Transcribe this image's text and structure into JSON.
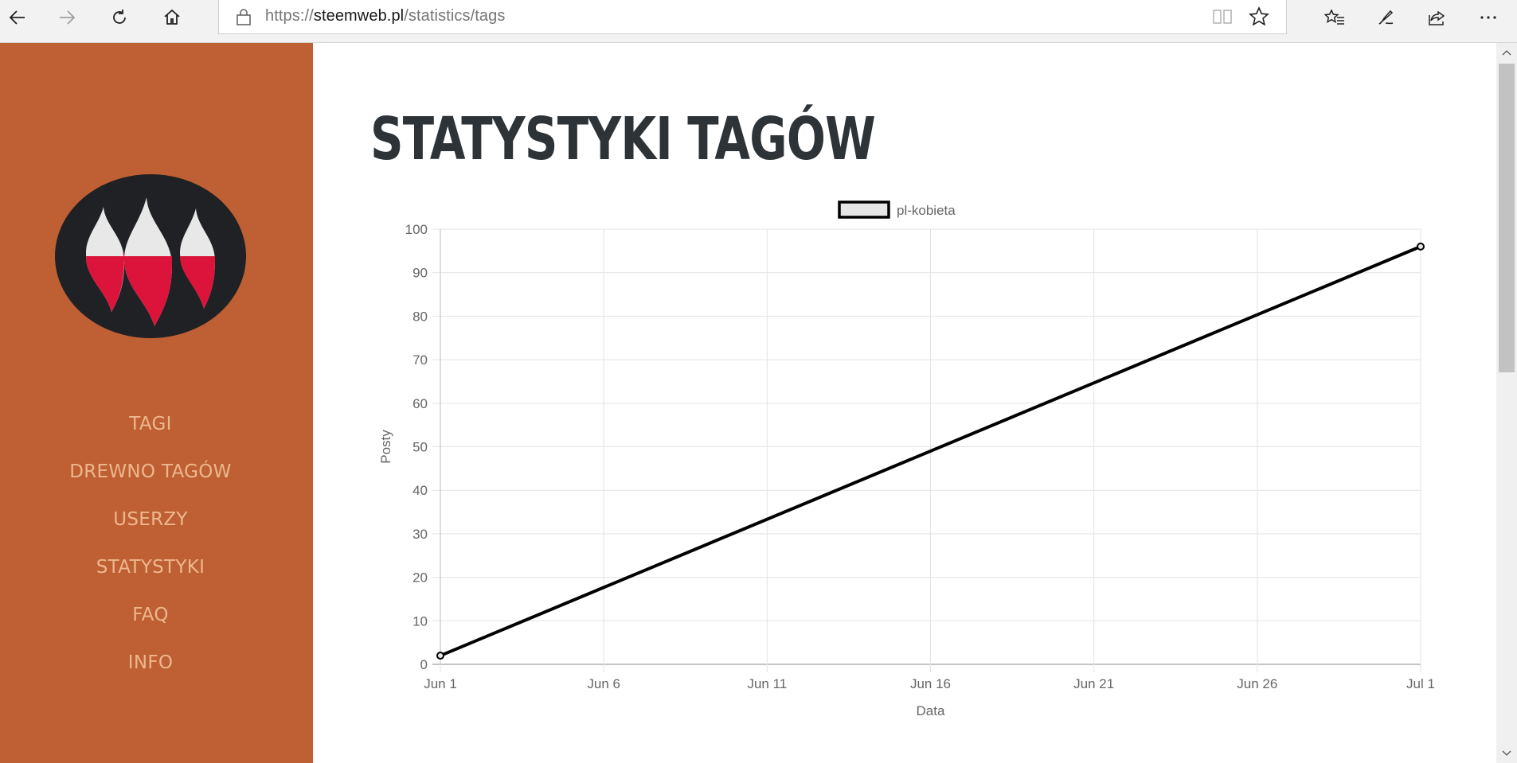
{
  "browser": {
    "url_scheme": "https://",
    "url_host": "steemweb.pl",
    "url_path": "/statistics/tags"
  },
  "sidebar": {
    "bg_color": "#bf5f34",
    "nav": [
      "TAGI",
      "DREWNO TAGÓW",
      "USERZY",
      "STATYSTYKI",
      "FAQ",
      "INFO"
    ]
  },
  "main": {
    "title": "STATYSTYKI TAGÓW"
  },
  "chart_data": {
    "type": "line",
    "x": [
      "Jun 1",
      "Jul 1"
    ],
    "series": [
      {
        "name": "pl-kobieta",
        "values": [
          2,
          96
        ],
        "color": "#000000"
      }
    ],
    "xlabel": "Data",
    "ylabel": "Posty",
    "ylim": [
      0,
      100
    ],
    "y_ticks": [
      0,
      10,
      20,
      30,
      40,
      50,
      60,
      70,
      80,
      90,
      100
    ],
    "x_ticks": [
      "Jun 1",
      "Jun 6",
      "Jun 11",
      "Jun 16",
      "Jun 21",
      "Jun 26",
      "Jul 1"
    ],
    "grid": true,
    "legend": "top"
  }
}
